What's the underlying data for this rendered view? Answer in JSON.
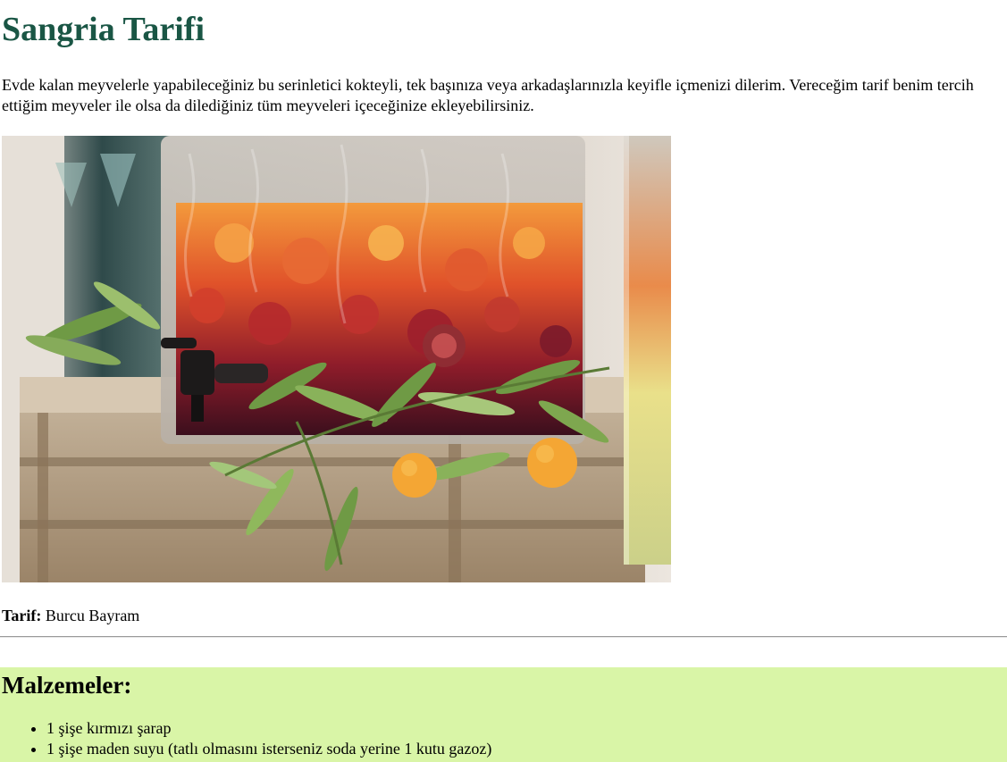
{
  "page": {
    "title": "Sangria Tarifi",
    "intro": "Evde kalan meyvelerle yapabileceğiniz bu serinletici kokteyli, tek başınıza veya arkadaşlarınızla keyifle içmenizi dilerim. Vereceğim tarif benim tercih ettiğim meyveler ile olsa da dilediğiniz tüm meyveleri içeceğinize ekleyebilirsiniz.",
    "photo_icon": "sangria-dispenser-photo",
    "credit_label": "Tarif:",
    "credit_name": "Burcu Bayram"
  },
  "ingredients": {
    "heading": "Malzemeler:",
    "items": [
      "1 şişe kırmızı şarap",
      "1 şişe maden suyu (tatlı olmasını isterseniz soda yerine 1 kutu gazoz)"
    ]
  },
  "colors": {
    "title": "#1a5645",
    "ingredients_bg": "#d9f5a7"
  }
}
